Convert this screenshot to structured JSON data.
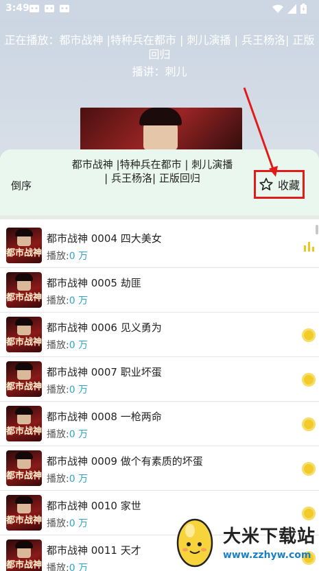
{
  "status_bar": {
    "time": "3:49"
  },
  "player": {
    "now_playing": "正在播放：都市战神 |特种兵在都市 |  刺儿演播 | 兵王杨洛| 正版回归",
    "narrator": "播讲：刺儿"
  },
  "sheet": {
    "order_label": "倒序",
    "title": "都市战神 |特种兵在都市 |  刺儿演播 | 兵王杨洛| 正版回归",
    "favorite_label": "收藏"
  },
  "thumb_logo": "都市战神",
  "plays_label": "播放:",
  "tracks": [
    {
      "title": "都市战神 0004 四大美女",
      "plays": "0 万",
      "status": "playing"
    },
    {
      "title": "都市战神 0005 劫匪",
      "plays": "0 万",
      "status": "none"
    },
    {
      "title": "都市战神 0006 见义勇为",
      "plays": "0 万",
      "status": "coin"
    },
    {
      "title": "都市战神 0007 职业坏蛋",
      "plays": "0 万",
      "status": "coin"
    },
    {
      "title": "都市战神 0008 一枪两命",
      "plays": "0 万",
      "status": "coin"
    },
    {
      "title": "都市战神 0009 做个有素质的坏蛋",
      "plays": "0 万",
      "status": "coin"
    },
    {
      "title": "都市战神 0010 家世",
      "plays": "0 万",
      "status": "coin"
    },
    {
      "title": "都市战神 0011 天才",
      "plays": "0 万",
      "status": "coin"
    }
  ],
  "watermark": {
    "name": "大米下载站",
    "url": "www.zzhyw.com"
  },
  "colors": {
    "accent": "#2ca5c9",
    "highlight_box": "#e11a1a",
    "coin": "#f1cb2a"
  }
}
